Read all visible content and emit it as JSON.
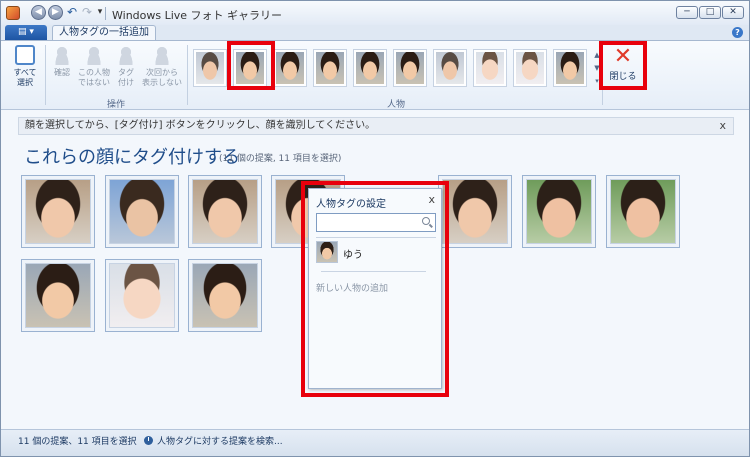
{
  "window": {
    "title": "Windows Live フォト ギャラリー",
    "minimize_glyph": "─",
    "maximize_glyph": "□",
    "close_glyph": "✕"
  },
  "quick_access": {
    "back_glyph": "◀",
    "forward_glyph": "▶",
    "undo_glyph": "↶",
    "redo_glyph": "↷",
    "dropdown_glyph": "▾"
  },
  "ribbon": {
    "menu_glyph": "▤ ▾",
    "active_tab": "人物タグの一括追加",
    "help_glyph": "?",
    "select_all_label": "すべて\n選択",
    "operations": {
      "confirm": "確認",
      "not_this_person": "この人物\nではない",
      "tag": "タグ\n付け",
      "hide_next_time": "次回から\n表示しない",
      "group_label": "操作"
    },
    "people": {
      "group_label": "人物",
      "scroll_up": "▲",
      "scroll_down": "▼",
      "more": "▾",
      "faces": [
        {
          "type": "adult"
        },
        {
          "type": "child"
        },
        {
          "type": "child"
        },
        {
          "type": "child"
        },
        {
          "type": "child"
        },
        {
          "type": "child"
        },
        {
          "type": "adult"
        },
        {
          "type": "baby"
        },
        {
          "type": "baby"
        },
        {
          "type": "child"
        }
      ]
    },
    "close_label": "閉じる",
    "close_glyph": "✕"
  },
  "infobar": {
    "text": "顔を選択してから、[タグ付け] ボタンをクリックし、顔を識別してください。",
    "close_glyph": "x"
  },
  "main": {
    "heading": "これらの顔にタグ付けする",
    "subheading": "(11 個の提案, 11 項目を選択)"
  },
  "popup": {
    "title": "人物タグの設定",
    "close_glyph": "x",
    "search_placeholder": "",
    "person_name": "ゆう",
    "add_person": "新しい人物の追加"
  },
  "statusbar": {
    "left": "11 個の提案、11 項目を選択",
    "right": "人物タグに対する提案を検索..."
  },
  "colors": {
    "highlight": "#e8000c",
    "accent": "#1f4d8a"
  }
}
